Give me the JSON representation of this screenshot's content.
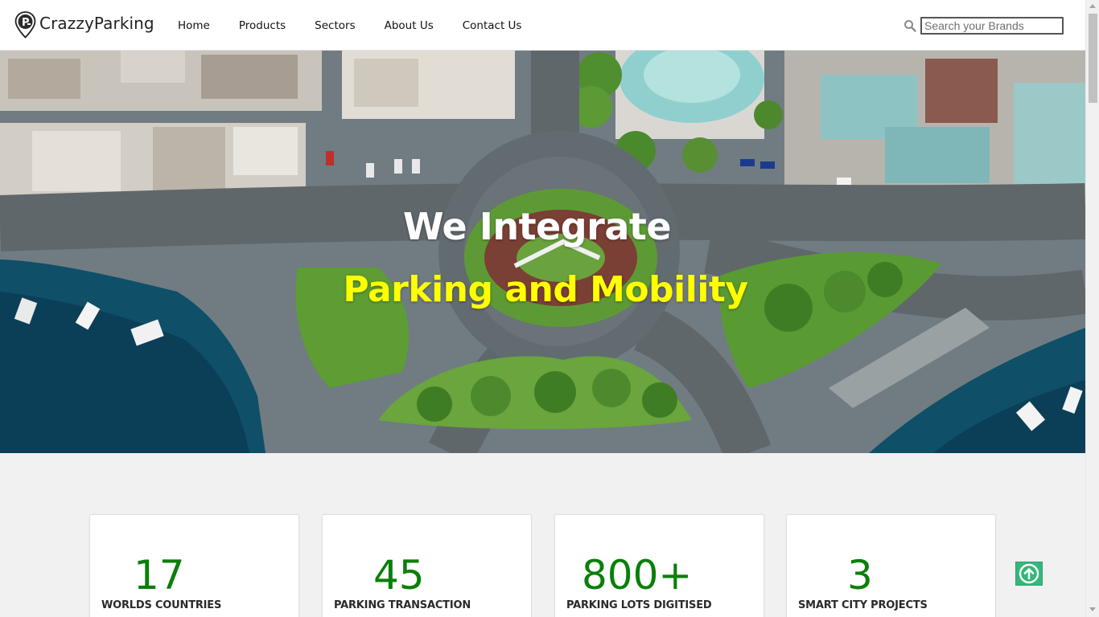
{
  "header": {
    "brand": "CrazzyParking",
    "nav": [
      "Home",
      "Products",
      "Sectors",
      "About Us",
      "Contact Us"
    ],
    "search": {
      "placeholder": "Search your Brands",
      "value": ""
    }
  },
  "hero": {
    "title": "We Integrate",
    "subtitle": "Parking and Mobility"
  },
  "stats": [
    {
      "value": "17",
      "label": "WORLDS COUNTRIES"
    },
    {
      "value": "45",
      "label": "PARKING TRANSACTION"
    },
    {
      "value": "800+",
      "label": "PARKING LOTS DIGITISED"
    },
    {
      "value": "3",
      "label": "SMART CITY PROJECTS"
    }
  ],
  "colors": {
    "accent_green": "#0a7f0a",
    "subtitle_yellow": "#ffff00",
    "to_top_button": "#34b77a",
    "page_background": "#f1f1f1"
  },
  "icons": {
    "logo": "parking-pin-icon",
    "search": "magnifier-icon",
    "back_to_top": "arrow-up-circle-icon"
  }
}
